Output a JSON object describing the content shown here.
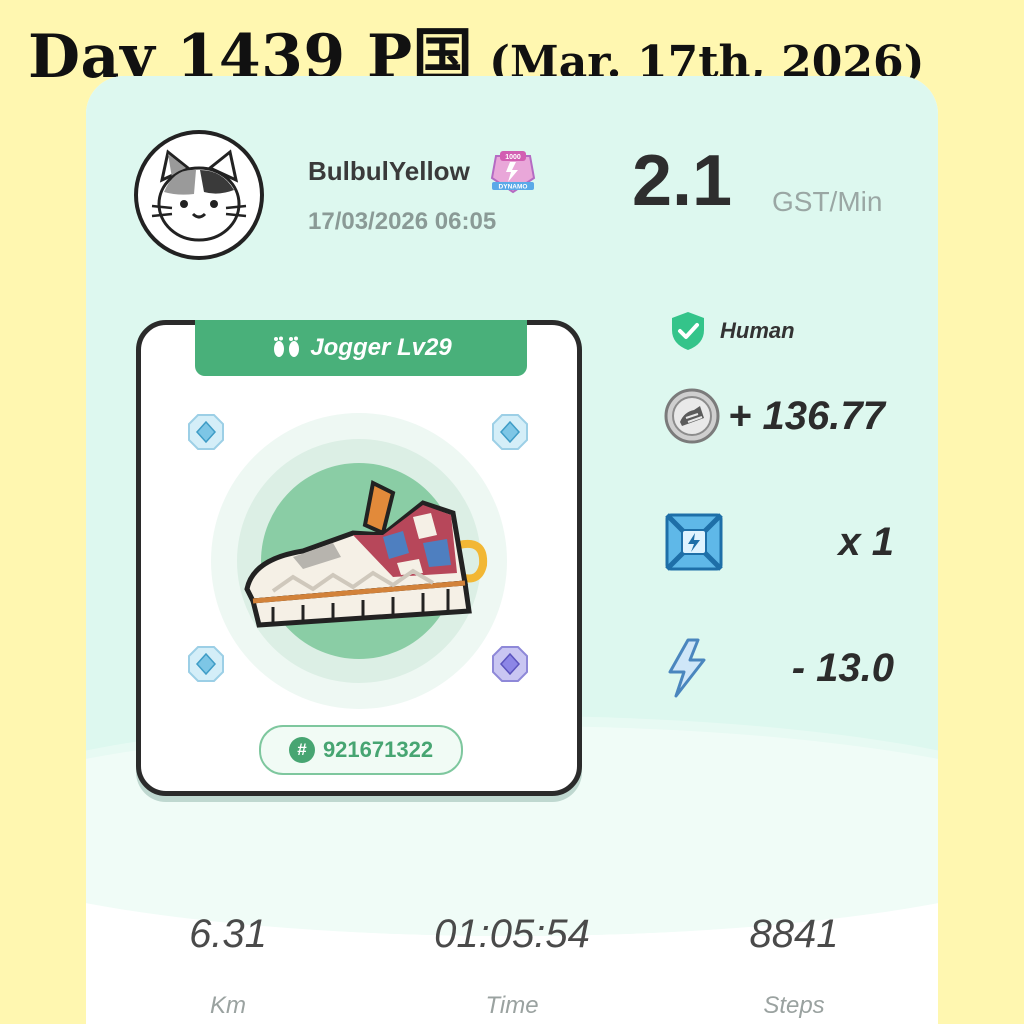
{
  "header": {
    "day": "Day 1439 P国",
    "date": "(Mar. 17th, 2026)"
  },
  "profile": {
    "username": "BulbulYellow",
    "badge_text": "DYNAMO",
    "badge_number": "1000",
    "timestamp": "17/03/2026 06:05"
  },
  "earning_rate": {
    "value": "2.1",
    "unit": "GST/Min"
  },
  "sneaker": {
    "type_label": "Jogger Lv29",
    "token_id": "921671322",
    "gem_colors": [
      "#7DC6E6",
      "#7DC6E6",
      "#7DC6E6",
      "#8C86E6"
    ]
  },
  "stats": {
    "human_label": "Human",
    "gst_earned": "+ 136.77",
    "mystery_box": "x 1",
    "energy": "- 13.0"
  },
  "summary": [
    {
      "value": "6.31",
      "label": "Km"
    },
    {
      "value": "01:05:54",
      "label": "Time"
    },
    {
      "value": "8841",
      "label": "Steps"
    }
  ],
  "colors": {
    "background": "#FFF7B0",
    "card_top": "#DDF8EF",
    "accent_green": "#49B07A"
  }
}
